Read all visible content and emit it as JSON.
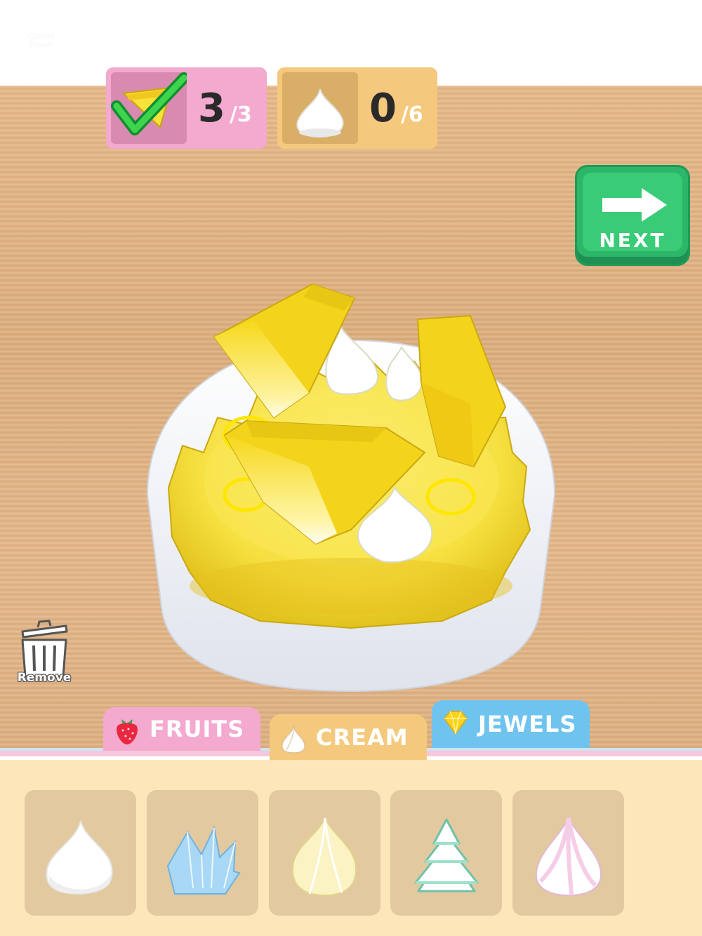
{
  "status_bar": {
    "line1": "Carrier",
    "line2": "Signal"
  },
  "counters": {
    "fruit": {
      "icon": "pineapple-check-icon",
      "current": "3",
      "total": "/3"
    },
    "cream": {
      "icon": "cream-dollop-icon",
      "current": "0",
      "total": "/6"
    }
  },
  "next_button": {
    "label": "NEXT",
    "icon": "arrow-right-icon"
  },
  "remove_button": {
    "label": "Remove",
    "icon": "trash-can-icon"
  },
  "tabs": [
    {
      "label": "FRUITS",
      "icon": "strawberry-icon",
      "color": "#f4a9cf"
    },
    {
      "label": "CREAM",
      "icon": "cream-icon",
      "color": "#f5c97d"
    },
    {
      "label": "JEWELS",
      "icon": "diamond-icon",
      "color": "#6fc4ef"
    }
  ],
  "cream_items": [
    {
      "icon": "white-cream-dollop-icon",
      "color": "#ffffff"
    },
    {
      "icon": "blue-petal-cream-icon",
      "color": "#a8d8f5"
    },
    {
      "icon": "yellow-cream-dollop-icon",
      "color": "#fbf3c4"
    },
    {
      "icon": "mint-tiered-cream-icon",
      "color": "#c9f0e4"
    },
    {
      "icon": "pink-swirl-cream-icon",
      "color": "#f5cde6"
    }
  ],
  "colors": {
    "accent_green": "#2cb66a",
    "wood": "#e2b586",
    "tray": "#fee6bb"
  }
}
